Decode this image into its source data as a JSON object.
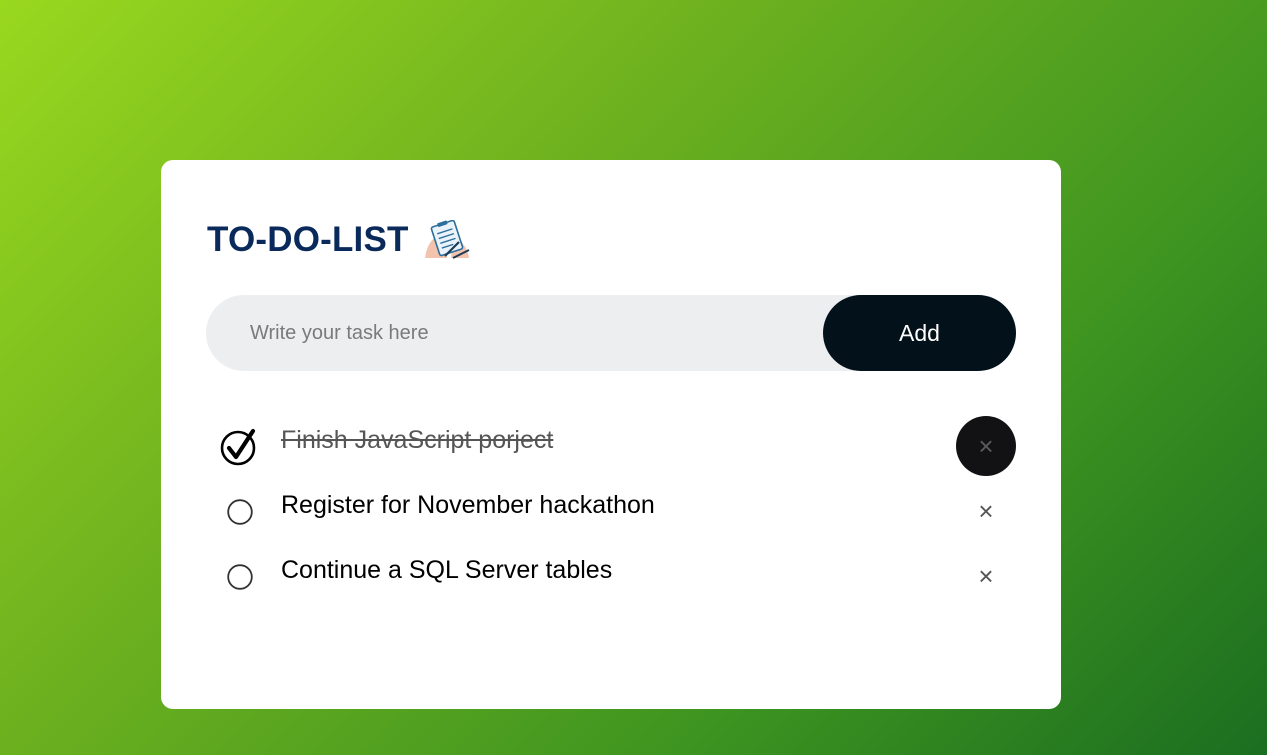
{
  "app": {
    "title": "TO-DO-LIST",
    "title_icon": "clipboard-checklist-icon"
  },
  "input": {
    "placeholder": "Write your task here",
    "value": ""
  },
  "add_button": {
    "label": "Add"
  },
  "tasks": [
    {
      "text": "Finish JavaScript porject",
      "completed": true,
      "delete_label": "×"
    },
    {
      "text": "Register for November hackathon",
      "completed": false,
      "delete_label": "×"
    },
    {
      "text": "Continue a SQL Server tables",
      "completed": false,
      "delete_label": "×"
    }
  ],
  "colors": {
    "title": "#0b2a5c",
    "add_button_bg": "#02111a",
    "input_bg": "#edeef0",
    "gradient_start": "#99d81f",
    "gradient_end": "#1b6e20"
  }
}
